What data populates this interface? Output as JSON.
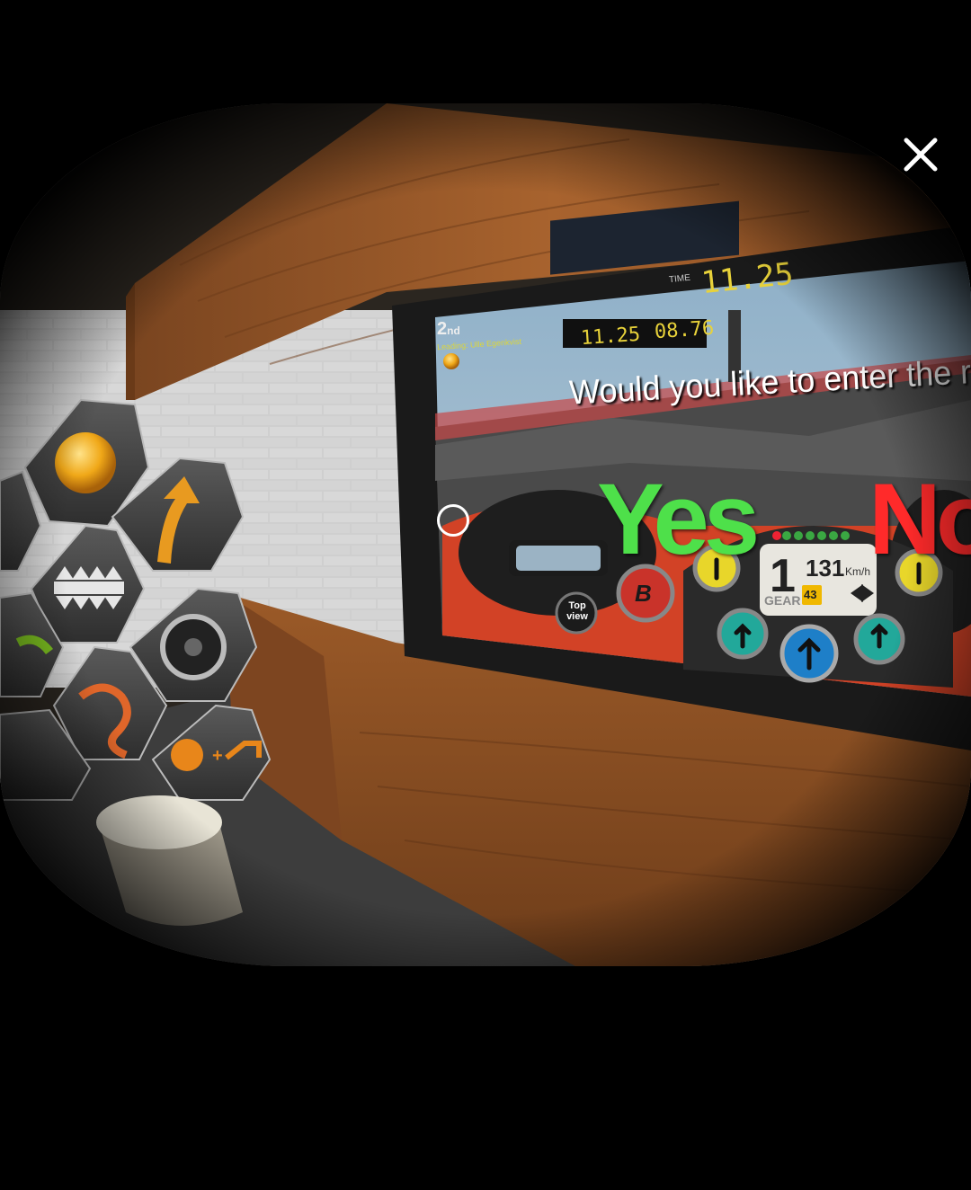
{
  "prompt": {
    "question": "Would you like to enter the r",
    "yes_label": "Yes",
    "no_label": "No"
  },
  "hud": {
    "position": "2",
    "position_suffix": "nd",
    "player_name": "Leading: Ulle Egenkvist",
    "lap_time": "11.25",
    "best_time": "08.76",
    "time_label": "TIME",
    "top_time": "11.25"
  },
  "dashboard": {
    "gear": "1",
    "gear_label": "GEAR",
    "speed": "131",
    "speed_unit": "Km/h",
    "fuel": "43",
    "b_button": "B",
    "top_view_label_1": "Top",
    "top_view_label_2": "view"
  },
  "colors": {
    "yes": "#4ee04a",
    "no": "#ff2a2a",
    "wood": "#9a5a2a"
  },
  "icons": {
    "close": "close-icon",
    "reticle": "gaze-reticle-icon"
  }
}
